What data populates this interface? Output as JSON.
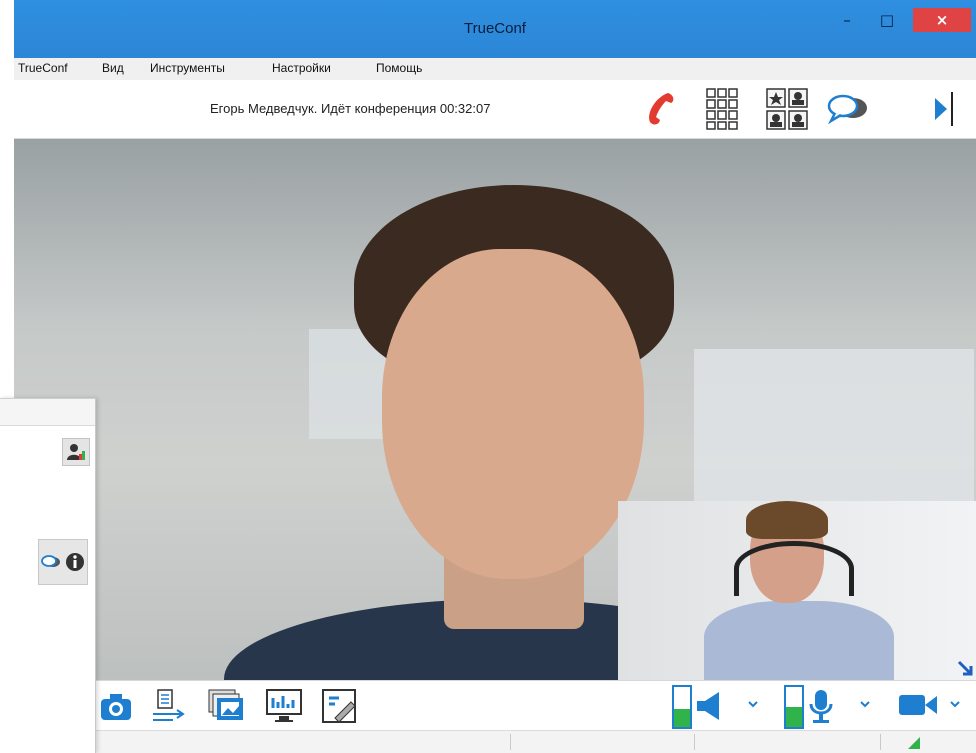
{
  "window": {
    "title": "TrueConf",
    "controls": {
      "minimize": "–",
      "maximize": "□",
      "close": "×"
    }
  },
  "menu": [
    "TrueConf",
    "Вид",
    "Инструменты",
    "Настройки",
    "Помощь"
  ],
  "call": {
    "status": "Егорь Медведчук. Идёт конференция 00:32:07"
  },
  "top_toolbar": {
    "icons": [
      "hangup-phone-icon",
      "dialpad-icon",
      "layout-grid-icon",
      "chat-bubbles-icon",
      "expand-right-icon"
    ]
  },
  "bottom_toolbar": {
    "icons": [
      "camera-snapshot-icon",
      "file-transfer-icon",
      "slideshow-icon",
      "screen-share-icon",
      "whiteboard-icon",
      "speaker-icon",
      "microphone-icon",
      "video-camera-icon"
    ]
  },
  "side_panel": {
    "icons": [
      "user-status-icon",
      "chat-icon",
      "info-icon"
    ]
  },
  "colors": {
    "titlebar": "#2c86d6",
    "close": "#e04343",
    "accent": "#1e7fd0",
    "hangup": "#e23b2f",
    "level": "#2fb34a"
  }
}
